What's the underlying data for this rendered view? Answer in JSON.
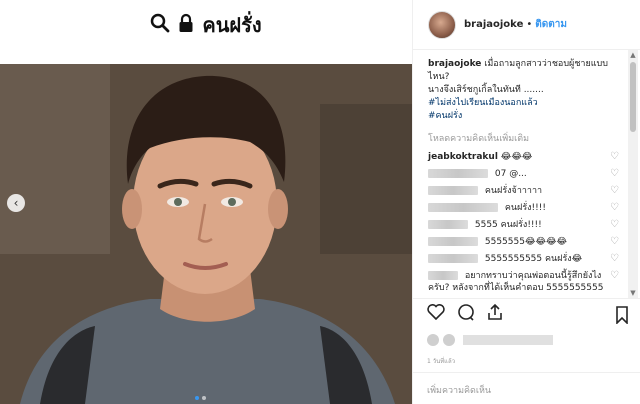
{
  "banner": {
    "title": "คนฝรั่ง"
  },
  "post": {
    "username": "brajaojoke",
    "separator": "•",
    "follow_label": "ติดตาม",
    "caption": {
      "user": "brajaojoke",
      "line1": "เมื่อถามลูกสาวว่าชอบผู้ชายแบบไหน?",
      "line2": "นางจึงเสิร์ชกูเกิ้ลในทันที .......",
      "tag1": "#ไม่ส่งไปเรียนเมืองนอกแล้ว",
      "tag2": "#คนฝรั่ง"
    },
    "load_more": "โหลดความคิดเห็นเพิ่มเติม",
    "comments": [
      {
        "user": "jeabkoktrakul",
        "text": "😂😂😂",
        "blur": 0
      },
      {
        "user": "",
        "text": "07 @...",
        "blur": 60
      },
      {
        "user": "",
        "text": "คนฝรั่งจ้าาาาา",
        "blur": 50
      },
      {
        "user": "",
        "text": "คนฝรั่ง!!!!",
        "blur": 70
      },
      {
        "user": "",
        "text": "5555 คนฝรั่ง!!!!",
        "blur": 40
      },
      {
        "user": "",
        "text": "5555555😂😂😂😂",
        "blur": 50
      },
      {
        "user": "",
        "text": "5555555555 คนฝรั่ง😂",
        "blur": 50
      },
      {
        "user": "",
        "text": "อยากทราบว่าคุณพ่อตอนนี้รู้สึกยังไงครับ? หลังจากที่ได้เห็นคำตอบ 5555555555",
        "blur": 30
      }
    ],
    "time": "1 วันที่แล้ว",
    "add_comment_placeholder": "เพิ่มความคิดเห็น"
  },
  "icons": {
    "search": "search-icon",
    "lock": "lock-icon",
    "heart": "heart-icon",
    "comment": "comment-icon",
    "share": "share-icon",
    "bookmark": "bookmark-icon",
    "prev": "chevron-left-icon"
  },
  "colors": {
    "accent": "#3897f0",
    "hashtag": "#003569",
    "muted": "#999999"
  }
}
